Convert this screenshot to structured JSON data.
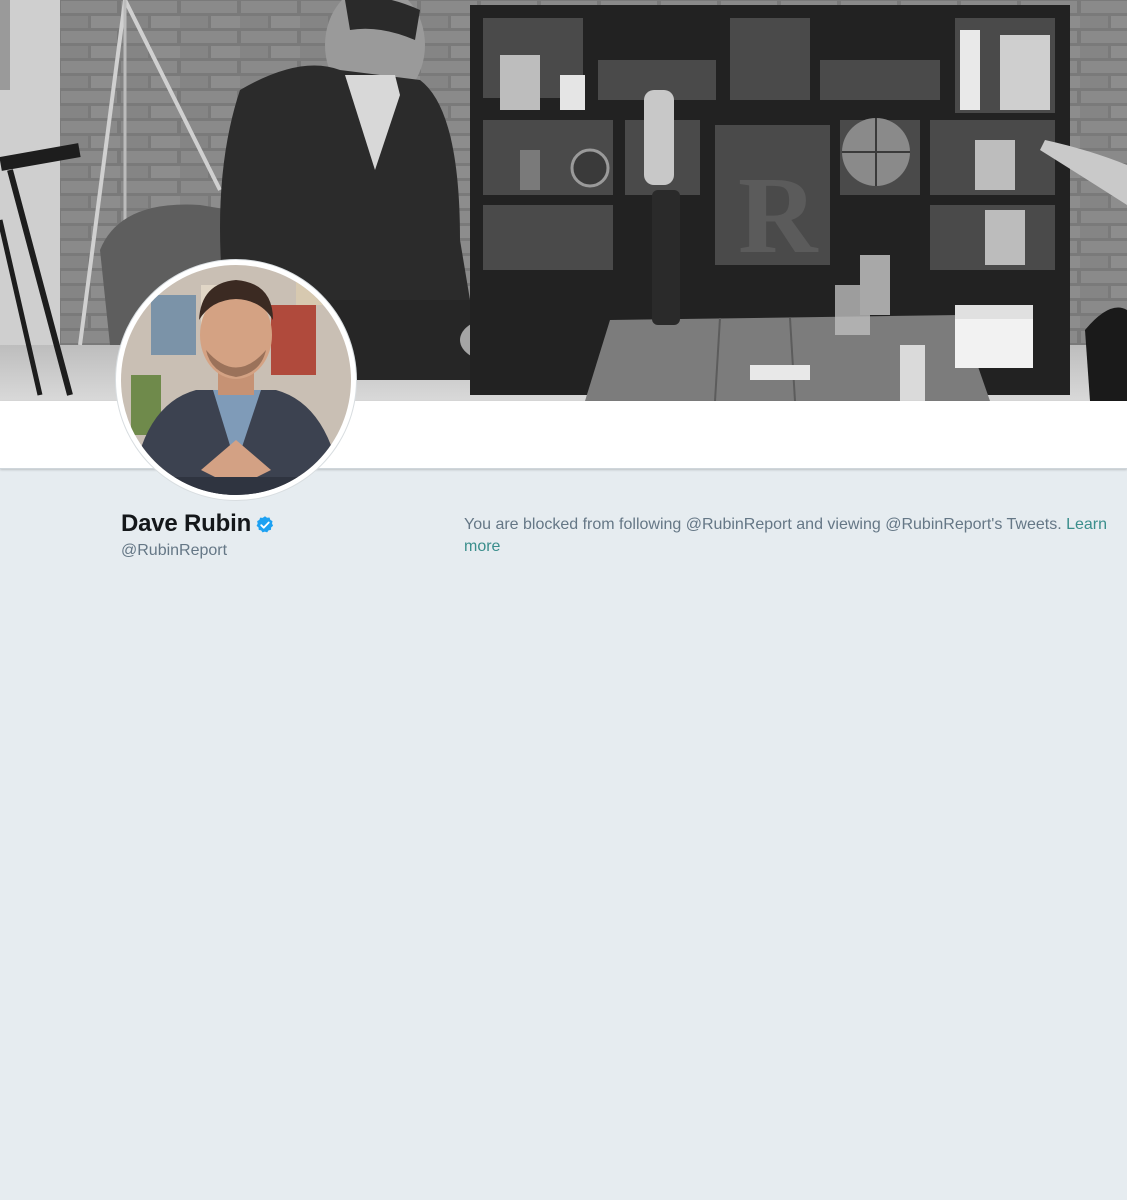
{
  "profile": {
    "display_name": "Dave Rubin",
    "handle": "@RubinReport",
    "verified": true
  },
  "notice": {
    "message": "You are blocked from following @RubinReport and viewing @RubinReport's Tweets.",
    "link_label": "Learn more"
  },
  "colors": {
    "page_background": "#e6ecf0",
    "link": "#3a8e8c",
    "verified_badge": "#1da1f2",
    "secondary_text": "#657786",
    "primary_text": "#14171a"
  },
  "icons": {
    "verified": "verified-badge-icon"
  }
}
